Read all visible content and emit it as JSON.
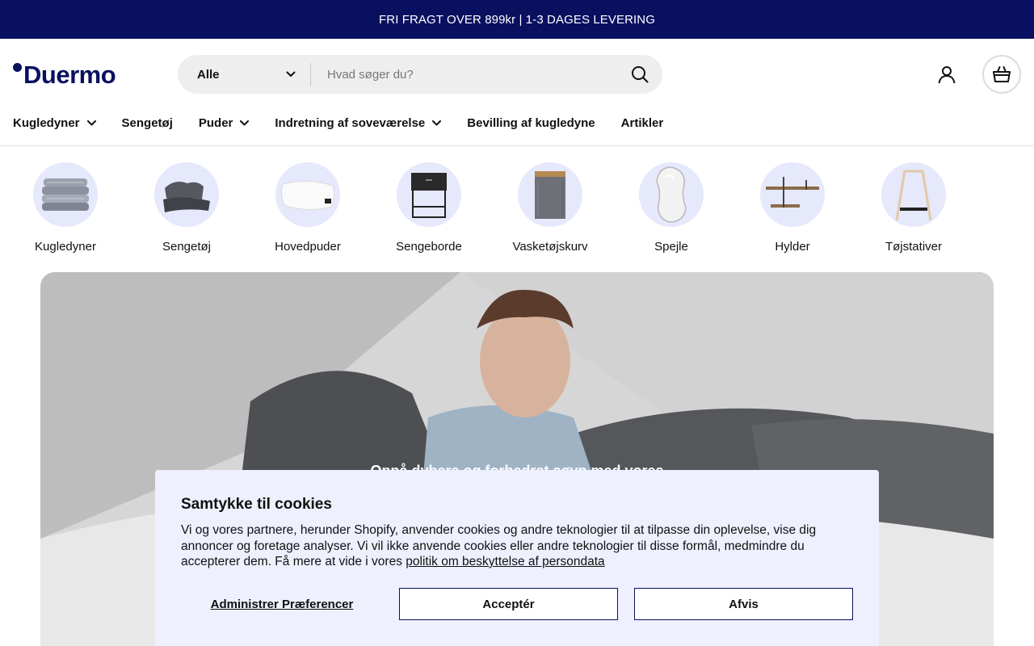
{
  "announcement": {
    "text": "FRI FRAGT OVER 899kr | 1-3 DAGES LEVERING"
  },
  "brand": {
    "name": "Duermo",
    "color": "#0a1060"
  },
  "search": {
    "category": "Alle",
    "placeholder": "Hvad søger du?"
  },
  "icons": {
    "search": "search-icon",
    "account": "user-icon",
    "cart": "shopping-basket-icon",
    "dropdown": "chevron-down-icon"
  },
  "nav": {
    "items": [
      {
        "label": "Kugledyner",
        "has_menu": true
      },
      {
        "label": "Sengetøj",
        "has_menu": false
      },
      {
        "label": "Puder",
        "has_menu": true
      },
      {
        "label": "Indretning af soveværelse",
        "has_menu": true
      },
      {
        "label": "Bevilling af kugledyne",
        "has_menu": false
      },
      {
        "label": "Artikler",
        "has_menu": false
      }
    ]
  },
  "categories": [
    {
      "label": "Kugledyner"
    },
    {
      "label": "Sengetøj"
    },
    {
      "label": "Hovedpuder"
    },
    {
      "label": "Sengeborde"
    },
    {
      "label": "Vasketøjskurv"
    },
    {
      "label": "Spejle"
    },
    {
      "label": "Hylder"
    },
    {
      "label": "Tøjstativer"
    }
  ],
  "hero": {
    "text": "Opnå dybere og forbedret søvn med vores"
  },
  "cookie": {
    "title": "Samtykke til cookies",
    "body": "Vi og vores partnere, herunder Shopify, anvender cookies og andre teknologier til at tilpasse din oplevelse, vise dig annoncer og foretage analyser. Vi vil ikke anvende cookies eller andre teknologier til disse formål, medmindre du accepterer dem. Få mere at vide i vores ",
    "link": "politik om beskyttelse af persondata",
    "prefs_label": "Administrer Præferencer",
    "accept_label": "Acceptér",
    "decline_label": "Afvis"
  }
}
